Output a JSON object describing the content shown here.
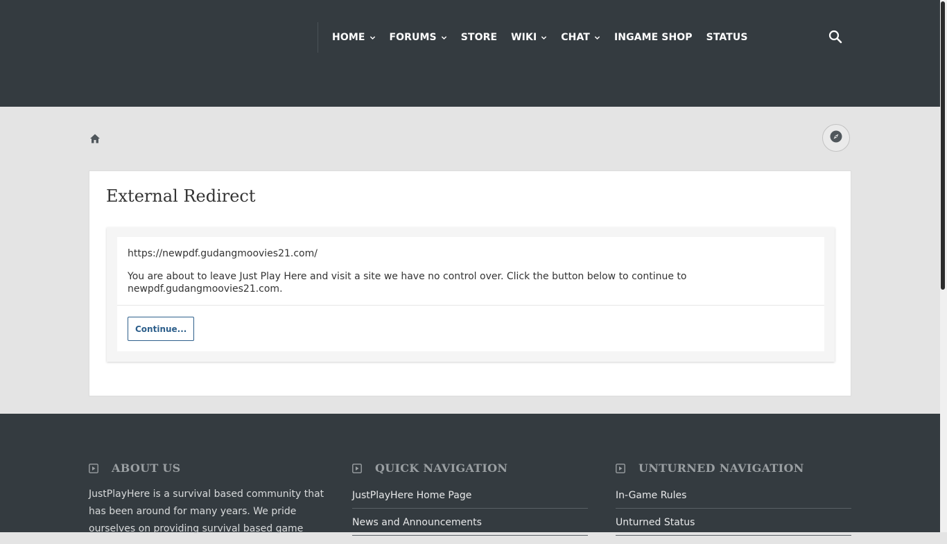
{
  "header": {
    "nav": [
      {
        "label": "HOME",
        "has_dropdown": true
      },
      {
        "label": "FORUMS",
        "has_dropdown": true
      },
      {
        "label": "STORE",
        "has_dropdown": false
      },
      {
        "label": "WIKI",
        "has_dropdown": true
      },
      {
        "label": "CHAT",
        "has_dropdown": true
      },
      {
        "label": "INGAME SHOP",
        "has_dropdown": false
      },
      {
        "label": "STATUS",
        "has_dropdown": false
      }
    ],
    "search_icon": "search-icon"
  },
  "breadcrumb": {
    "home_icon": "home-icon",
    "compass_icon": "compass-icon"
  },
  "main": {
    "title": "External Redirect",
    "url": "https://newpdf.gudangmoovies21.com/",
    "message": "You are about to leave Just Play Here and visit a site we have no control over. Click the button below to continue to newpdf.gudangmoovies21.com.",
    "continue_label": "Continue..."
  },
  "footer": {
    "about": {
      "title": "ABOUT US",
      "text": "JustPlayHere is a survival based community that has been around for many years. We pride ourselves on providing survival based game"
    },
    "quick_nav": {
      "title": "QUICK NAVIGATION",
      "links": [
        "JustPlayHere Home Page",
        "News and Announcements"
      ]
    },
    "unturned_nav": {
      "title": "UNTURNED NAVIGATION",
      "links": [
        "In-Game Rules",
        "Unturned Status"
      ]
    }
  },
  "colors": {
    "header_bg": "#343b40",
    "page_bg": "#e4e4e4",
    "accent": "#2d5f8b",
    "footer_heading": "#9a9fa2"
  }
}
